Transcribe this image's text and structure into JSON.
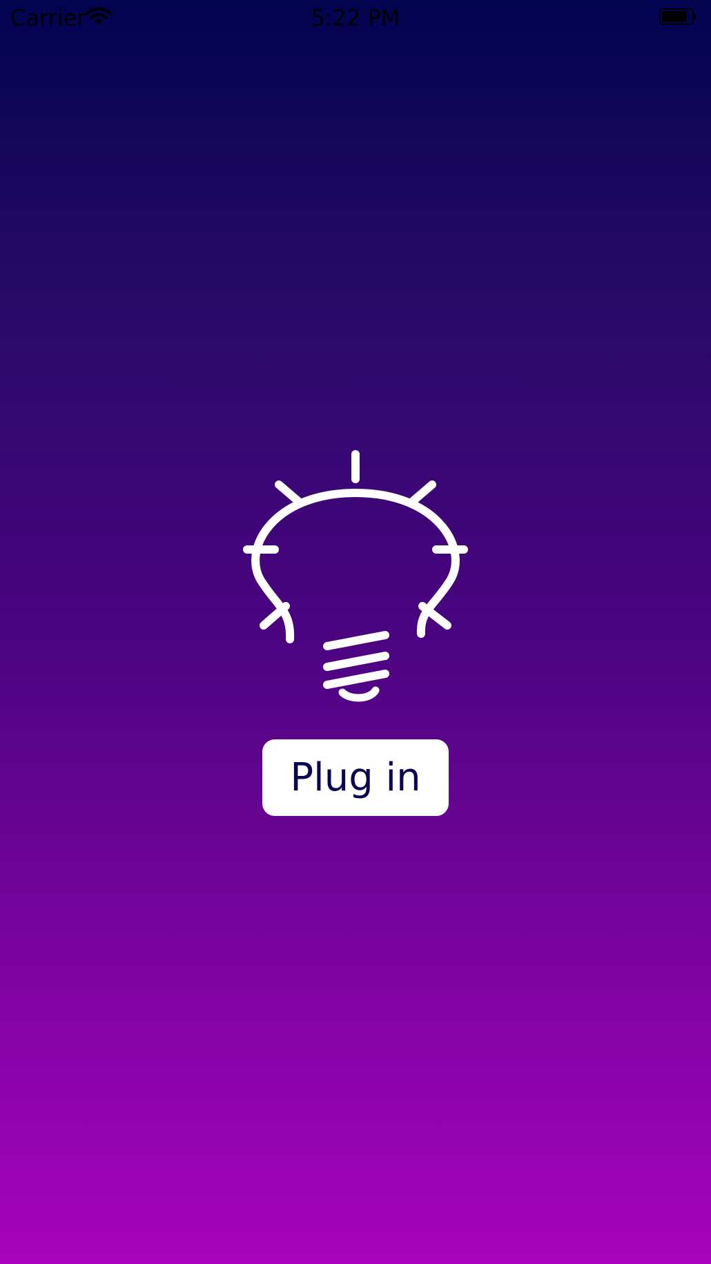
{
  "status_bar": {
    "carrier": "Carrier",
    "time": "5:22 PM",
    "wifi_icon": "wifi-icon",
    "battery_icon": "battery-icon"
  },
  "main": {
    "icon": "light-bulb-icon",
    "button_label": "Plug in"
  },
  "colors": {
    "gradient_top": "#020450",
    "gradient_bottom": "#a703bc",
    "button_background": "#ffffff",
    "button_text": "#0b0653",
    "icon_color": "#ffffff"
  }
}
